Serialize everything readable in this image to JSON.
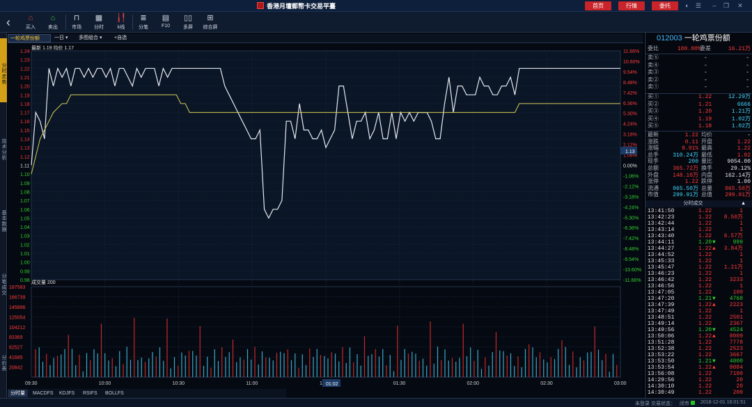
{
  "titlebar": {
    "title": "香港月壇郵幣卡交易平臺",
    "buttons": [
      "首页",
      "行情",
      "委托"
    ]
  },
  "toolbar": {
    "items": [
      {
        "label": "买入",
        "icon": "house-buy-icon"
      },
      {
        "label": "卖出",
        "icon": "house-sell-icon"
      },
      {
        "label": "市场",
        "icon": "shopping-bag-icon"
      },
      {
        "label": "分时",
        "icon": "minute-chart-icon"
      },
      {
        "label": "k线",
        "icon": "candlestick-icon"
      },
      {
        "label": "分笔",
        "icon": "tick-list-icon"
      },
      {
        "label": "F10",
        "icon": "document-icon"
      },
      {
        "label": "多屏",
        "icon": "multi-screen-icon"
      },
      {
        "label": "综合屏",
        "icon": "grid-screen-icon"
      }
    ]
  },
  "left_tabs": [
    "分时走势",
    "技术分析",
    "基本数据",
    "分笔成交",
    "分价表"
  ],
  "subbar": {
    "name": "一轮鸡票份额",
    "period": "一日",
    "layout": "多图组合",
    "watch": "+自选"
  },
  "chart_data": {
    "type": "line",
    "price_label": "最新 1.19 均价 1.17",
    "volume_label": "成交量 200",
    "cursor_price": "1.13",
    "cursor_time": "01:02",
    "y_price_ticks": [
      "1.24",
      "1.23",
      "1.22",
      "1.21",
      "1.20",
      "1.19",
      "1.18",
      "1.17",
      "1.16",
      "1.15",
      "1.14",
      "1.13",
      "1.12",
      "1.11",
      "1.10",
      "1.09",
      "1.08",
      "1.07",
      "1.06",
      "1.05",
      "1.04",
      "1.03",
      "1.02",
      "1.01",
      "1.00",
      "0.99",
      "0.98"
    ],
    "pct_ticks": [
      "11.66%",
      "10.60%",
      "9.54%",
      "8.48%",
      "7.42%",
      "6.36%",
      "5.30%",
      "4.24%",
      "3.18%",
      "2.12%",
      "1.06%",
      "0.00%",
      "-1.06%",
      "-2.12%",
      "-3.18%",
      "-4.24%",
      "-5.30%",
      "-6.36%",
      "-7.42%",
      "-8.48%",
      "-9.54%",
      "-10.60%",
      "-11.66%"
    ],
    "vol_ticks": [
      "187583",
      "166739",
      "145896",
      "125054",
      "104212",
      "83369",
      "62527",
      "41685",
      "20842"
    ],
    "x_ticks": [
      "09:30",
      "10:00",
      "10:30",
      "11:00",
      "11:30",
      "01:30",
      "02:00",
      "02:30",
      "03:00"
    ],
    "ylim": [
      0.98,
      1.24
    ],
    "price_series": [
      1.11,
      1.17,
      1.16,
      1.14,
      1.22,
      1.2,
      1.22,
      1.21,
      1.22,
      1.2,
      1.22,
      1.22,
      1.21,
      1.22,
      1.21,
      1.22,
      1.22,
      1.21,
      1.22,
      1.2,
      1.22,
      1.22,
      1.21,
      1.2,
      1.22,
      1.21,
      1.22,
      1.22,
      1.22,
      1.2,
      1.22,
      1.21,
      1.22,
      1.22,
      1.22,
      1.22,
      1.22,
      1.22,
      1.22,
      1.22,
      1.22,
      1.22,
      1.22,
      1.22,
      1.2,
      1.19,
      1.18,
      1.17,
      1.16,
      1.15,
      1.14,
      1.14,
      1.15,
      1.06,
      1.05,
      1.06,
      1.06,
      1.07,
      1.16,
      1.16,
      1.14,
      1.18,
      1.15,
      1.15,
      1.14,
      1.14,
      1.15,
      1.13,
      1.14,
      1.15,
      1.2,
      1.2,
      1.17,
      1.14,
      1.16,
      1.16,
      1.17,
      1.14,
      1.15,
      1.17,
      1.14,
      1.14,
      1.17,
      1.14,
      1.17,
      1.16,
      1.17,
      1.16,
      1.17,
      1.17,
      1.17,
      1.16,
      1.14,
      1.14,
      1.18,
      1.21,
      1.17,
      1.2,
      1.2,
      1.19,
      1.19,
      1.19,
      1.21,
      1.2,
      1.2,
      1.19,
      1.19,
      1.2,
      1.2,
      1.21,
      1.19,
      1.22,
      1.22,
      1.22,
      1.22,
      1.22,
      1.22,
      1.22,
      1.22,
      1.22,
      1.22,
      1.22,
      1.22,
      1.22,
      1.22,
      1.22,
      1.22,
      1.22,
      1.22,
      1.22,
      1.22,
      1.22,
      1.22,
      1.22,
      1.22
    ],
    "avg_series": [
      1.1,
      1.12,
      1.14,
      1.15,
      1.16,
      1.17,
      1.175,
      1.18,
      1.18,
      1.19,
      1.19,
      1.19,
      1.19,
      1.19,
      1.19,
      1.19,
      1.19,
      1.19,
      1.19,
      1.19,
      1.19,
      1.19,
      1.19,
      1.19,
      1.19,
      1.19,
      1.19,
      1.19,
      1.19,
      1.19,
      1.19,
      1.19,
      1.19,
      1.19,
      1.18,
      1.18,
      1.17,
      1.17,
      1.17,
      1.17,
      1.17,
      1.17,
      1.17,
      1.17,
      1.17,
      1.17,
      1.17,
      1.17,
      1.17,
      1.17,
      1.17,
      1.17,
      1.17,
      1.17,
      1.17,
      1.17,
      1.17,
      1.17,
      1.17,
      1.17,
      1.17,
      1.17,
      1.17,
      1.17,
      1.17,
      1.17,
      1.17,
      1.17,
      1.17,
      1.17,
      1.17,
      1.17,
      1.17,
      1.17,
      1.17,
      1.17,
      1.17,
      1.17,
      1.17,
      1.17,
      1.17,
      1.17,
      1.17,
      1.17,
      1.17,
      1.17,
      1.17,
      1.17,
      1.17,
      1.17,
      1.17,
      1.17,
      1.17,
      1.17,
      1.17,
      1.17,
      1.17,
      1.17,
      1.17,
      1.17,
      1.17,
      1.17,
      1.17,
      1.17,
      1.17,
      1.17,
      1.17,
      1.17,
      1.17,
      1.17,
      1.17,
      1.18,
      1.18,
      1.18,
      1.18,
      1.18,
      1.18,
      1.18,
      1.18,
      1.18,
      1.18,
      1.18,
      1.18,
      1.18,
      1.18,
      1.18,
      1.18,
      1.18,
      1.18,
      1.18,
      1.18,
      1.18,
      1.18,
      1.18,
      1.18
    ]
  },
  "quote": {
    "code": "012003",
    "name": "一轮鸡票份额",
    "weibi_label": "委比",
    "weibi": "100.00%",
    "weicha_label": "委差",
    "weicha": "16.21万",
    "sell": [
      {
        "l": "卖⑤",
        "p": "-",
        "v": "-"
      },
      {
        "l": "卖④",
        "p": "-",
        "v": "-"
      },
      {
        "l": "卖③",
        "p": "-",
        "v": "-"
      },
      {
        "l": "卖②",
        "p": "-",
        "v": "-"
      },
      {
        "l": "卖①",
        "p": "-",
        "v": "-"
      }
    ],
    "buy": [
      {
        "l": "买①",
        "p": "1.22",
        "v": "12.29万"
      },
      {
        "l": "买②",
        "p": "1.21",
        "v": "6666"
      },
      {
        "l": "买③",
        "p": "1.20",
        "v": "1.21万"
      },
      {
        "l": "买④",
        "p": "1.19",
        "v": "1.02万"
      },
      {
        "l": "买⑤",
        "p": "1.18",
        "v": "1.02万"
      }
    ],
    "stats": [
      [
        "最新",
        "1.22",
        "均价",
        "-"
      ],
      [
        "涨跌",
        "0.11",
        "开盘",
        "1.22"
      ],
      [
        "涨幅",
        "9.91%",
        "最高",
        "1.22"
      ],
      [
        "总手",
        "310.24万",
        "最低",
        "1.02"
      ],
      [
        "现手",
        "200",
        "量比",
        "9054.00"
      ],
      [
        "总额",
        "365.72万",
        "换手",
        "29.12%"
      ],
      [
        "外盘",
        "148.10万",
        "内盘",
        "162.14万"
      ],
      [
        "涨停",
        "1.22",
        "跌停",
        "1.00"
      ],
      [
        "流通",
        "065.50万",
        "总量",
        "065.50万"
      ],
      [
        "市值",
        "299.91万",
        "总值",
        "299.91万"
      ]
    ],
    "ticks_title": "分时成交",
    "ticks": [
      [
        "13:41:50",
        "1.22",
        "",
        "1"
      ],
      [
        "13:42:23",
        "1.22",
        "",
        "8.50万"
      ],
      [
        "13:42:44",
        "1.22",
        "",
        "1"
      ],
      [
        "13:43:14",
        "1.22",
        "",
        "1"
      ],
      [
        "13:43:40",
        "1.22",
        "",
        "6.57万"
      ],
      [
        "13:44:11",
        "1.20",
        "▼",
        "999"
      ],
      [
        "13:44:27",
        "1.22",
        "▲",
        "3.84万"
      ],
      [
        "13:44:52",
        "1.22",
        "",
        "1"
      ],
      [
        "13:45:33",
        "1.22",
        "",
        "1"
      ],
      [
        "13:45:47",
        "1.22",
        "",
        "1.21万"
      ],
      [
        "13:46:23",
        "1.22",
        "",
        "1"
      ],
      [
        "13:46:42",
        "1.22",
        "",
        "3233"
      ],
      [
        "13:46:56",
        "1.22",
        "",
        "1"
      ],
      [
        "13:47:05",
        "1.22",
        "",
        "100"
      ],
      [
        "13:47:20",
        "1.21",
        "▼",
        "4768"
      ],
      [
        "13:47:39",
        "1.22",
        "▲",
        "2223"
      ],
      [
        "13:47:49",
        "1.22",
        "",
        "1"
      ],
      [
        "13:48:51",
        "1.22",
        "",
        "2501"
      ],
      [
        "13:49:14",
        "1.22",
        "",
        "2367"
      ],
      [
        "13:49:56",
        "1.20",
        "▼",
        "4524"
      ],
      [
        "13:50:06",
        "1.22",
        "▲",
        "8009"
      ],
      [
        "13:51:28",
        "1.22",
        "",
        "7778"
      ],
      [
        "13:52:38",
        "1.22",
        "",
        "2523"
      ],
      [
        "13:53:22",
        "1.22",
        "",
        "3667"
      ],
      [
        "13:53:50",
        "1.21",
        "▼",
        "4000"
      ],
      [
        "13:53:54",
        "1.22",
        "▲",
        "8084"
      ],
      [
        "13:56:08",
        "1.22",
        "",
        "7100"
      ],
      [
        "14:29:56",
        "1.22",
        "",
        "20"
      ],
      [
        "14:30:10",
        "1.22",
        "",
        "20"
      ],
      [
        "14:30:49",
        "1.22",
        "",
        "200"
      ]
    ]
  },
  "bottom_tabs": [
    "分时量",
    "MACDFS",
    "KDJFS",
    "RSIFS",
    "BOLLFS"
  ],
  "status": {
    "login": "未登录",
    "trade": "交易状态：",
    "state": "闭市",
    "datetime": "2018-12-01 16:01:51"
  }
}
